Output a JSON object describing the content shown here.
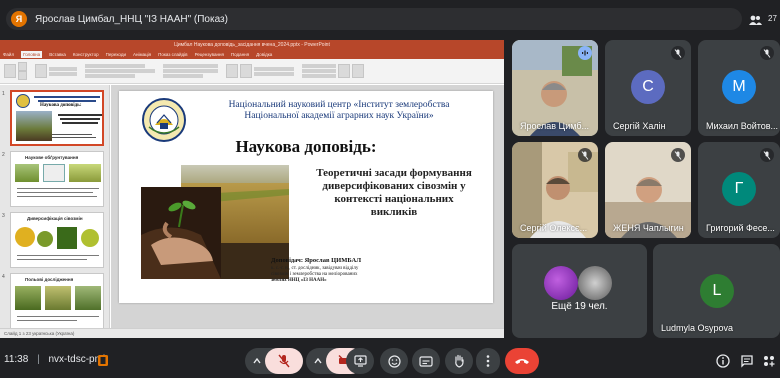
{
  "presenter_bar": {
    "avatar_letter": "Я",
    "title": "Ярослав Цимбал_ННЦ \"ІЗ НААН\" (Показ)",
    "participant_count": "27"
  },
  "presentation": {
    "title_bar": "Цимбал Наукова доповідь_засідання вчена_2024.pptx - PowerPoint",
    "tabs": [
      "Файл",
      "Головна",
      "Вставка",
      "Конструктор",
      "Переходи",
      "Анімація",
      "Показ слайдів",
      "Рецензування",
      "Подання",
      "Довідка"
    ],
    "active_tab_index": 1,
    "slide": {
      "org_line1": "Національний науковий центр «Інститут землеробства",
      "org_line2": "Національної академії аграрних наук України»",
      "heading": "Наукова доповідь:",
      "topic_line1": "Теоретичні засади формування",
      "topic_line2": "диверсифікованих сівозмін у",
      "topic_line3": "контексті національних",
      "topic_line4": "викликів",
      "speaker_label": "Доповідач: Ярослав ЦИМБАЛ",
      "speaker_line1": "к. с.-г. н., ст. дослідник, завідувач відділу",
      "speaker_line2": "сівозмін і землеробства на меліорованих",
      "speaker_line3": "землях ННЦ «ІЗ НААН»"
    },
    "thumbnails": [
      {
        "num": "1",
        "caption": "Наукова доповідь:"
      },
      {
        "num": "2",
        "caption": "Наукове обґрунтування"
      },
      {
        "num": "3",
        "caption": "Диверсифікація сівозмін"
      },
      {
        "num": "4",
        "caption": "Польові дослідження"
      }
    ],
    "notes_placeholder": "Примітки до слайда",
    "status_text": "Слайд 1 з 23   українська (Україна)"
  },
  "tiles": [
    {
      "name": "Ярослав Цимб...",
      "kind": "video"
    },
    {
      "name": "Сергій Халін",
      "letter": "С",
      "color": "#5c6bc0",
      "kind": "avatar"
    },
    {
      "name": "Михаил Войтов...",
      "letter": "М",
      "color": "#1e88e5",
      "kind": "avatar"
    },
    {
      "name": "Сергій Олексє...",
      "kind": "video"
    },
    {
      "name": "ЖЕНЯ Чаплыгин",
      "kind": "video"
    },
    {
      "name": "Григорий Фесе...",
      "letter": "Г",
      "color": "#00897b",
      "kind": "avatar"
    },
    {
      "name": "Ещё 19 чел.",
      "kind": "more"
    },
    {
      "name": "Ludmyla Osypova",
      "letter": "L",
      "color": "#2e7d32",
      "kind": "avatar"
    }
  ],
  "bottom_bar": {
    "time": "11:38",
    "meeting_code": "nvx-tdsc-pmi"
  },
  "colors": {
    "accent_red": "#ea4335",
    "muted_bg": "#f9dedc",
    "powerpoint": "#b7472a"
  }
}
